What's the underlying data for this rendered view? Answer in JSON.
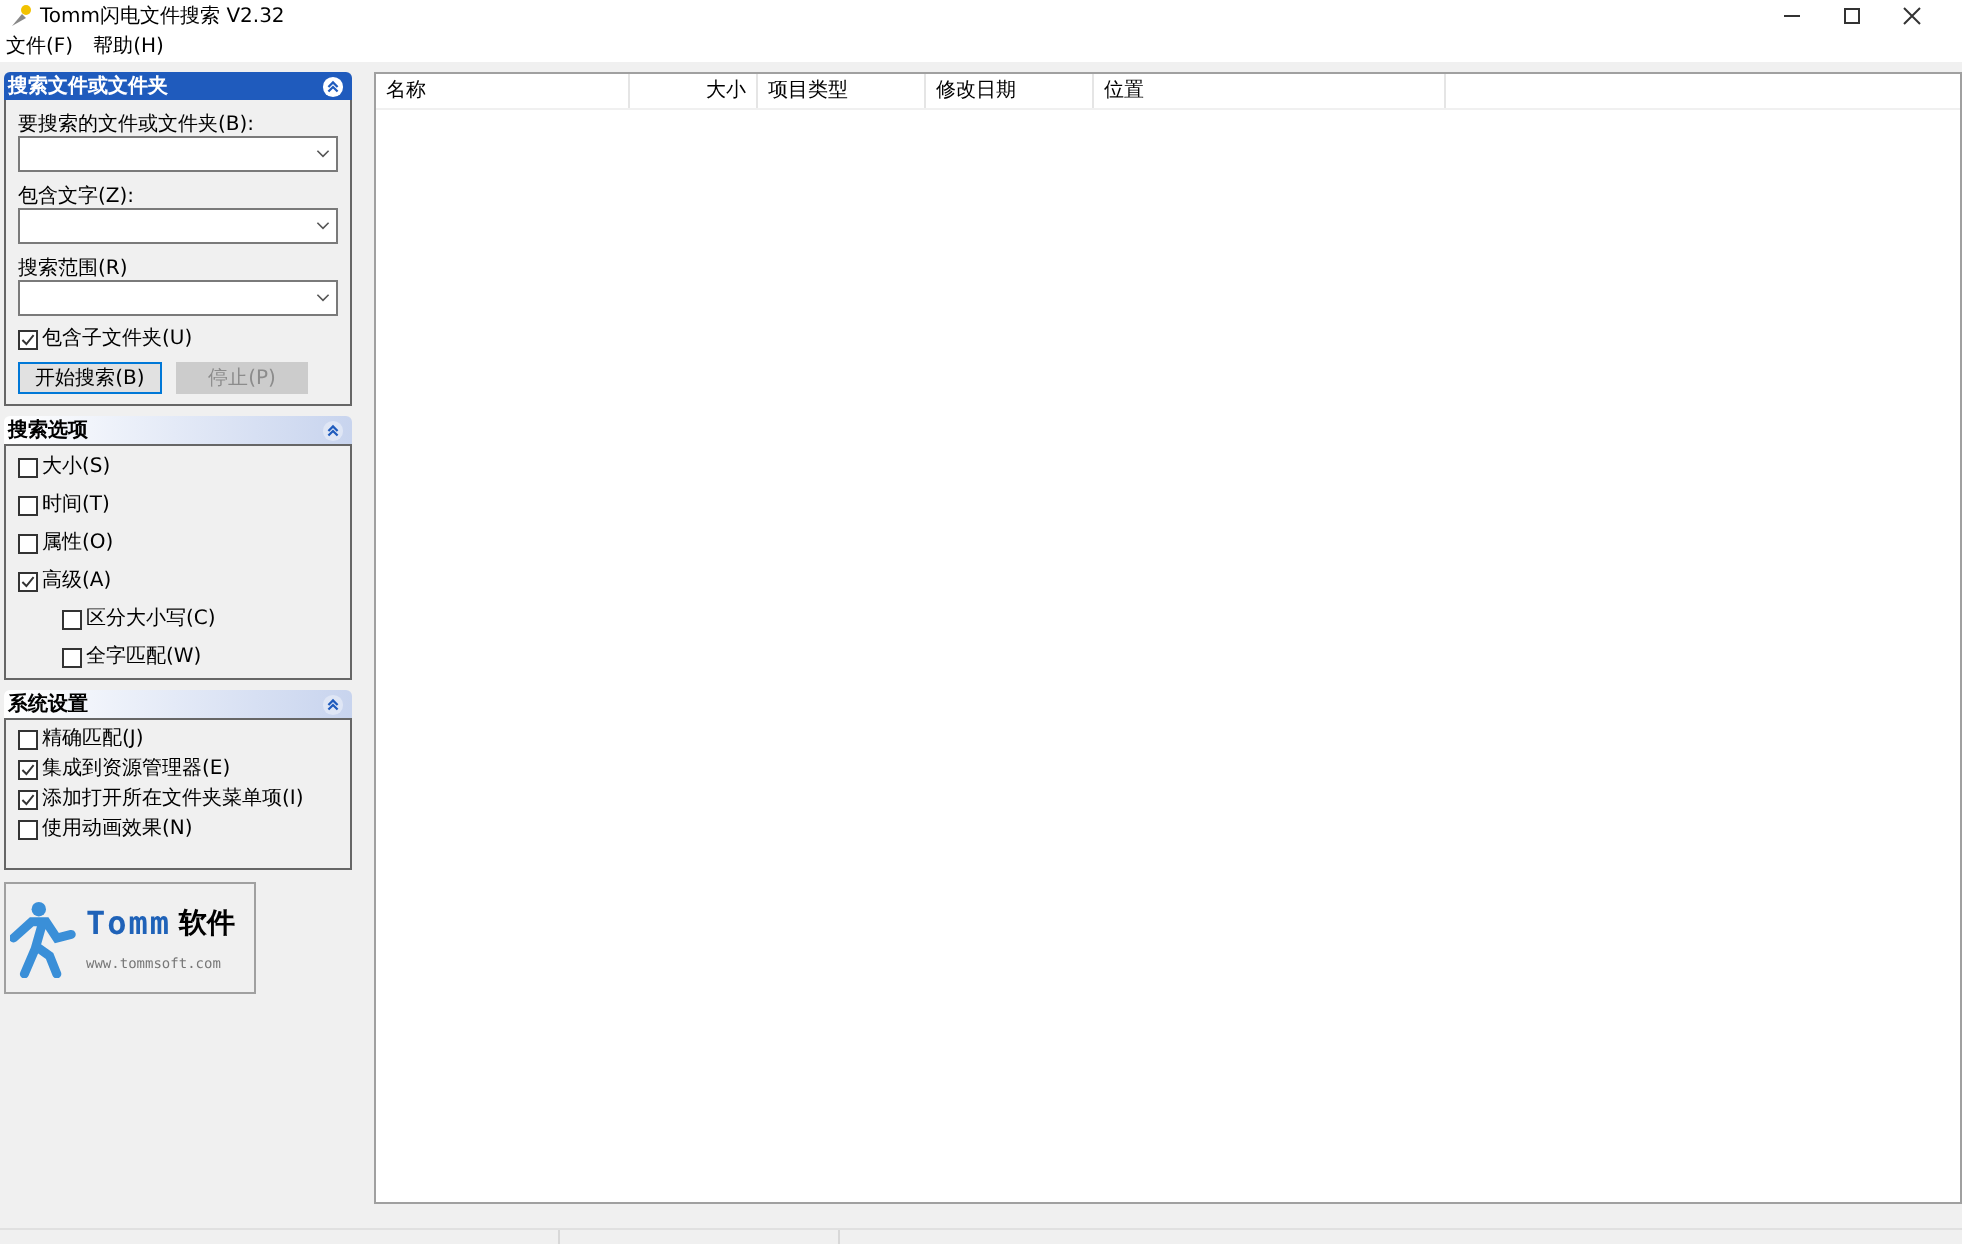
{
  "window": {
    "title": "Tomm闪电文件搜索 V2.32"
  },
  "menu": [
    "文件(F)",
    "帮助(H)"
  ],
  "search_panel": {
    "title": "搜索文件或文件夹",
    "fields": [
      {
        "label": "要搜索的文件或文件夹(B):"
      },
      {
        "label": "包含文字(Z):"
      },
      {
        "label": "搜索范围(R)"
      }
    ],
    "include_subfolders": {
      "label": "包含子文件夹(U)",
      "checked": true
    },
    "buttons": [
      {
        "label": "开始搜索(B)",
        "disabled": false
      },
      {
        "label": "停止(P)",
        "disabled": true
      }
    ]
  },
  "options_panel": {
    "title": "搜索选项",
    "items": [
      {
        "label": "大小(S)",
        "checked": false
      },
      {
        "label": "时间(T)",
        "checked": false
      },
      {
        "label": "属性(O)",
        "checked": false
      },
      {
        "label": "高级(A)",
        "checked": true,
        "children": [
          {
            "label": "区分大小写(C)",
            "checked": false
          },
          {
            "label": "全字匹配(W)",
            "checked": false
          }
        ]
      }
    ]
  },
  "settings_panel": {
    "title": "系统设置",
    "items": [
      {
        "label": "精确匹配(J)",
        "checked": false
      },
      {
        "label": "集成到资源管理器(E)",
        "checked": true
      },
      {
        "label": "添加打开所在文件夹菜单项(I)",
        "checked": true
      },
      {
        "label": "使用动画效果(N)",
        "checked": false
      }
    ]
  },
  "logo": {
    "brand": "Tomm",
    "suffix": "软件",
    "url": "www.tommsoft.com"
  },
  "table": {
    "columns": [
      {
        "label": "名称",
        "kind": "text"
      },
      {
        "label": "大小",
        "kind": "number"
      },
      {
        "label": "项目类型",
        "kind": "text"
      },
      {
        "label": "修改日期",
        "kind": "text"
      },
      {
        "label": "位置",
        "kind": "text"
      }
    ]
  }
}
